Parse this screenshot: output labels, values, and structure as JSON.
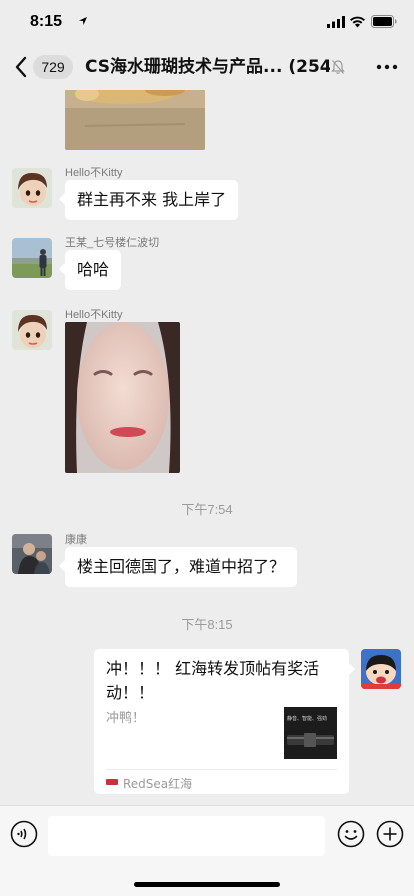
{
  "status_bar": {
    "time": "8:15"
  },
  "nav": {
    "unread_count": "729",
    "title": "CS海水珊瑚技术与产品...",
    "member_count": "(254)"
  },
  "messages": [
    {
      "sender": "Hello不Kitty",
      "text": "群主再不来 我上岸了"
    },
    {
      "sender": "王某_七号楼仁波切",
      "text": "哈哈"
    },
    {
      "sender": "Hello不Kitty"
    },
    {
      "sender": "康康",
      "text": "楼主回德国了，难道中招了？"
    }
  ],
  "timestamps": [
    "下午7:54",
    "下午8:15"
  ],
  "link_card": {
    "title": "冲！！！ 红海转发顶帖有奖活动！！",
    "description": "冲鸭！",
    "source": "RedSea红海",
    "thumb_text": "静音、智能、强劲"
  },
  "colors": {
    "background": "#ededed",
    "bubble": "#ffffff",
    "input_bar": "#f6f6f6"
  }
}
